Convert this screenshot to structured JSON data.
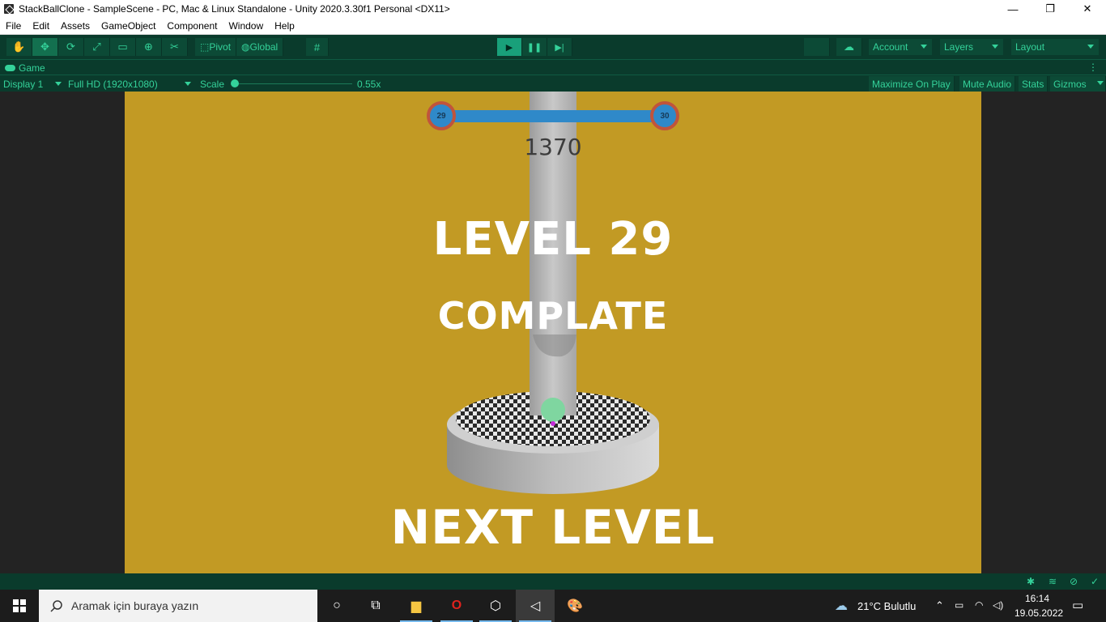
{
  "window": {
    "title": "StackBallClone - SampleScene - PC, Mac & Linux Standalone - Unity 2020.3.30f1 Personal <DX11>",
    "controls": [
      "—",
      "❐",
      "✕"
    ]
  },
  "menu": [
    "File",
    "Edit",
    "Assets",
    "GameObject",
    "Component",
    "Window",
    "Help"
  ],
  "toolbar": {
    "pivot_label": "Pivot",
    "global_label": "Global",
    "account_label": "Account",
    "layers_label": "Layers",
    "layout_label": "Layout"
  },
  "game_tab": {
    "label": "Game"
  },
  "game_bar": {
    "display": "Display 1",
    "resolution": "Full HD (1920x1080)",
    "scale_label": "Scale",
    "scale_value": "0.55x",
    "maximize_on_play": "Maximize On Play",
    "mute_audio": "Mute Audio",
    "stats": "Stats",
    "gizmos": "Gizmos"
  },
  "game": {
    "current_level": "29",
    "next_level": "30",
    "score": "1370",
    "level_text": "LEVEL 29",
    "complete_text": "COMPLATE",
    "next_level_text": "NEXT LEVEL",
    "colors": {
      "background": "#c29a24",
      "progress": "#2f89c9",
      "ring": "#c0543c",
      "ball": "#7fd6a0"
    }
  },
  "taskbar": {
    "search_placeholder": "Aramak için buraya yazın",
    "weather": "21°C  Bulutlu",
    "time": "16:14",
    "date": "19.05.2022"
  }
}
